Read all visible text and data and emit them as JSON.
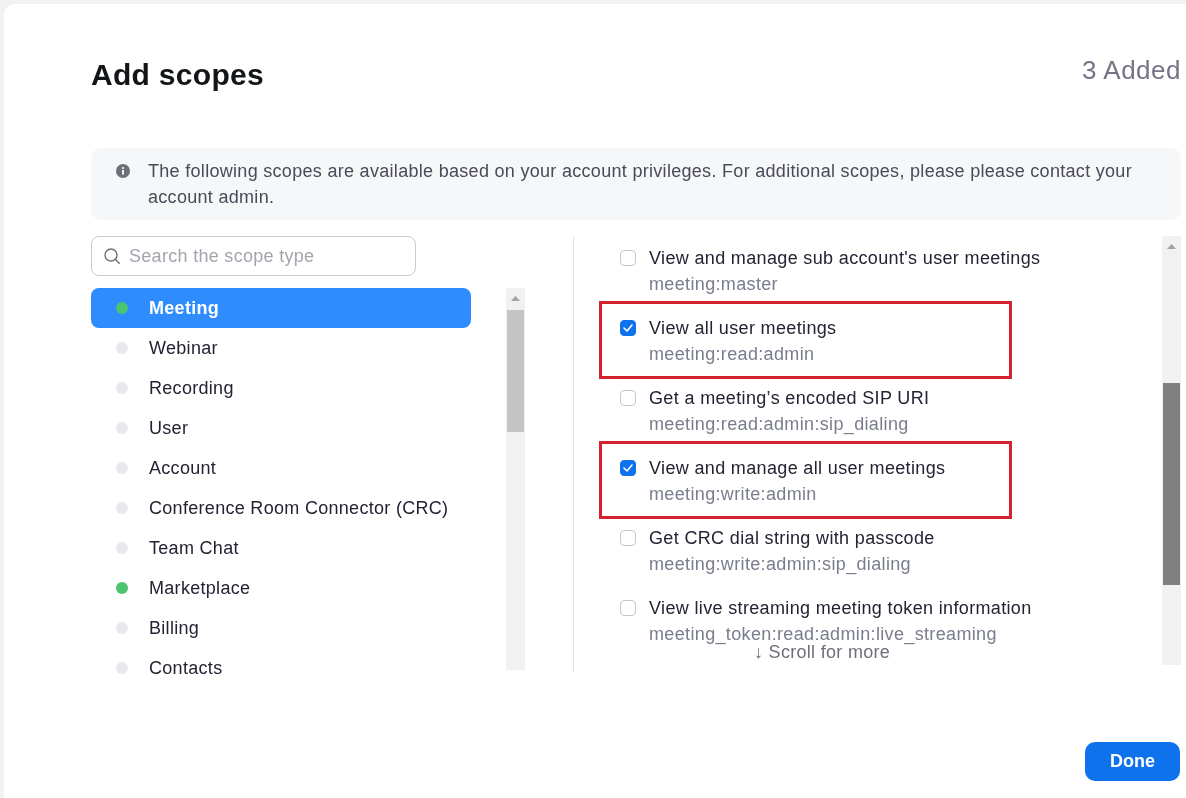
{
  "dialog": {
    "title": "Add scopes",
    "added_count": "3 Added"
  },
  "notice": {
    "text": "The following scopes are available based on your account privileges. For additional scopes, please please contact your account admin."
  },
  "search": {
    "placeholder": "Search the scope type"
  },
  "categories": [
    {
      "label": "Meeting",
      "selected": true,
      "color": "#4cc36f"
    },
    {
      "label": "Webinar",
      "selected": false,
      "color": "#e8e9ef"
    },
    {
      "label": "Recording",
      "selected": false,
      "color": "#e8e9ef"
    },
    {
      "label": "User",
      "selected": false,
      "color": "#e8e9ef"
    },
    {
      "label": "Account",
      "selected": false,
      "color": "#e8e9ef"
    },
    {
      "label": "Conference Room Connector (CRC)",
      "selected": false,
      "color": "#e8e9ef"
    },
    {
      "label": "Team Chat",
      "selected": false,
      "color": "#e8e9ef"
    },
    {
      "label": "Marketplace",
      "selected": false,
      "color": "#4cc36f"
    },
    {
      "label": "Billing",
      "selected": false,
      "color": "#e8e9ef"
    },
    {
      "label": "Contacts",
      "selected": false,
      "color": "#e8e9ef"
    }
  ],
  "scopes": [
    {
      "title": "View and manage sub account's user meetings",
      "id": "meeting:master",
      "checked": false,
      "highlighted": false
    },
    {
      "title": "View all user meetings",
      "id": "meeting:read:admin",
      "checked": true,
      "highlighted": true
    },
    {
      "title": "Get a meeting’s encoded SIP URI",
      "id": "meeting:read:admin:sip_dialing",
      "checked": false,
      "highlighted": false
    },
    {
      "title": "View and manage all user meetings",
      "id": "meeting:write:admin",
      "checked": true,
      "highlighted": true
    },
    {
      "title": "Get CRC dial string with passcode",
      "id": "meeting:write:admin:sip_dialing",
      "checked": false,
      "highlighted": false
    },
    {
      "title": "View live streaming meeting token information",
      "id": "meeting_token:read:admin:live_streaming",
      "checked": false,
      "highlighted": false
    }
  ],
  "scroll_hint": "↓ Scroll for more",
  "buttons": [
    {
      "label": "Done",
      "kind": "primary"
    }
  ]
}
